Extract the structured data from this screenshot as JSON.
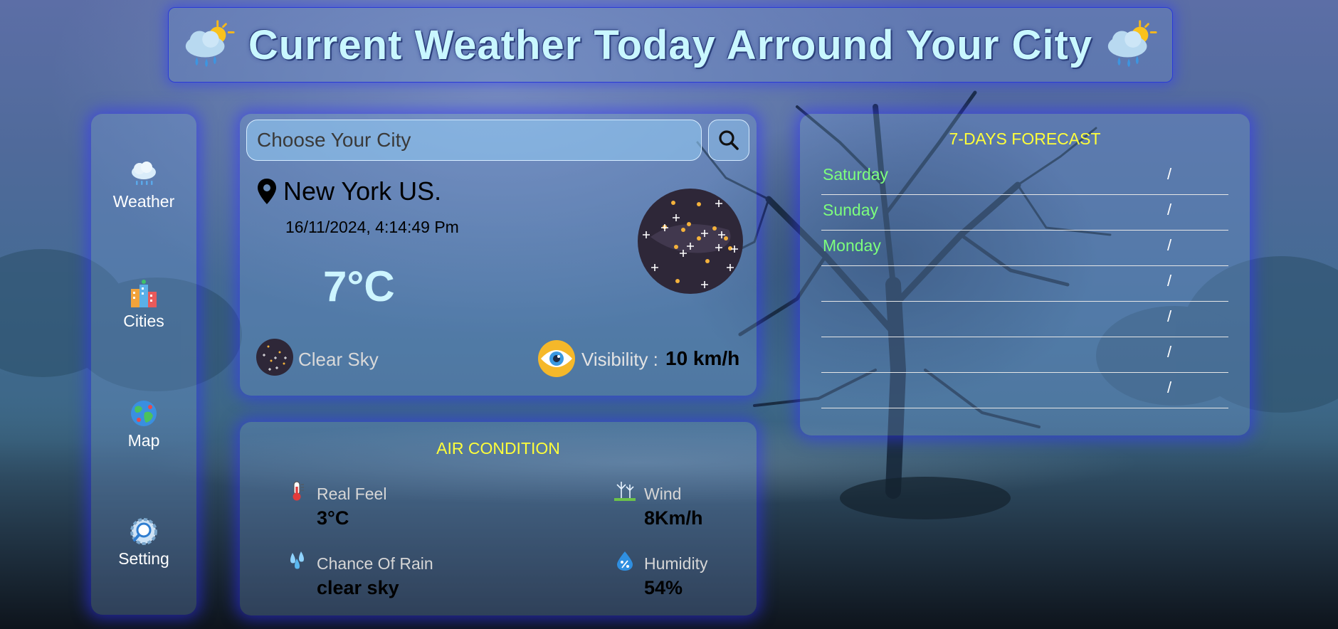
{
  "header": {
    "title": "Current Weather Today Arround Your City",
    "left_icon": "rain-sun-cloud-icon",
    "right_icon": "rain-sun-cloud-icon"
  },
  "sidebar": {
    "items": [
      {
        "label": "Weather",
        "icon": "cloud-rain-icon"
      },
      {
        "label": "Cities",
        "icon": "city-buildings-icon"
      },
      {
        "label": "Map",
        "icon": "globe-icon"
      },
      {
        "label": "Setting",
        "icon": "gear-search-icon"
      }
    ]
  },
  "weather": {
    "search_placeholder": "Choose Your City",
    "search_icon": "search-icon",
    "location": "New York US.",
    "datetime": "16/11/2024, 4:14:49 Pm",
    "temperature": "7°C",
    "condition": "Clear Sky",
    "condition_icon": "night-sky-icon",
    "visibility_label": "Visibility :",
    "visibility_value": "10 km/h"
  },
  "air_condition": {
    "title": "AIR CONDITION",
    "real_feel": {
      "label": "Real Feel",
      "value": "3°C",
      "icon": "thermometer-icon"
    },
    "wind": {
      "label": "Wind",
      "value": "8Km/h",
      "icon": "wind-turbine-icon"
    },
    "chance_of_rain": {
      "label": "Chance Of Rain",
      "value": "clear sky",
      "icon": "rain-drops-icon"
    },
    "humidity": {
      "label": "Humidity",
      "value": "54%",
      "icon": "humidity-drop-icon"
    }
  },
  "forecast": {
    "title": "7-DAYS FORECAST",
    "separator": "/",
    "days": [
      "Saturday",
      "Sunday",
      "Monday",
      "",
      "",
      "",
      ""
    ]
  },
  "colors": {
    "accent_yellow": "#ffff3a",
    "day_green": "#7dff7d",
    "glow_blue": "#3232ff",
    "title_cyan": "#c9f7ff"
  }
}
